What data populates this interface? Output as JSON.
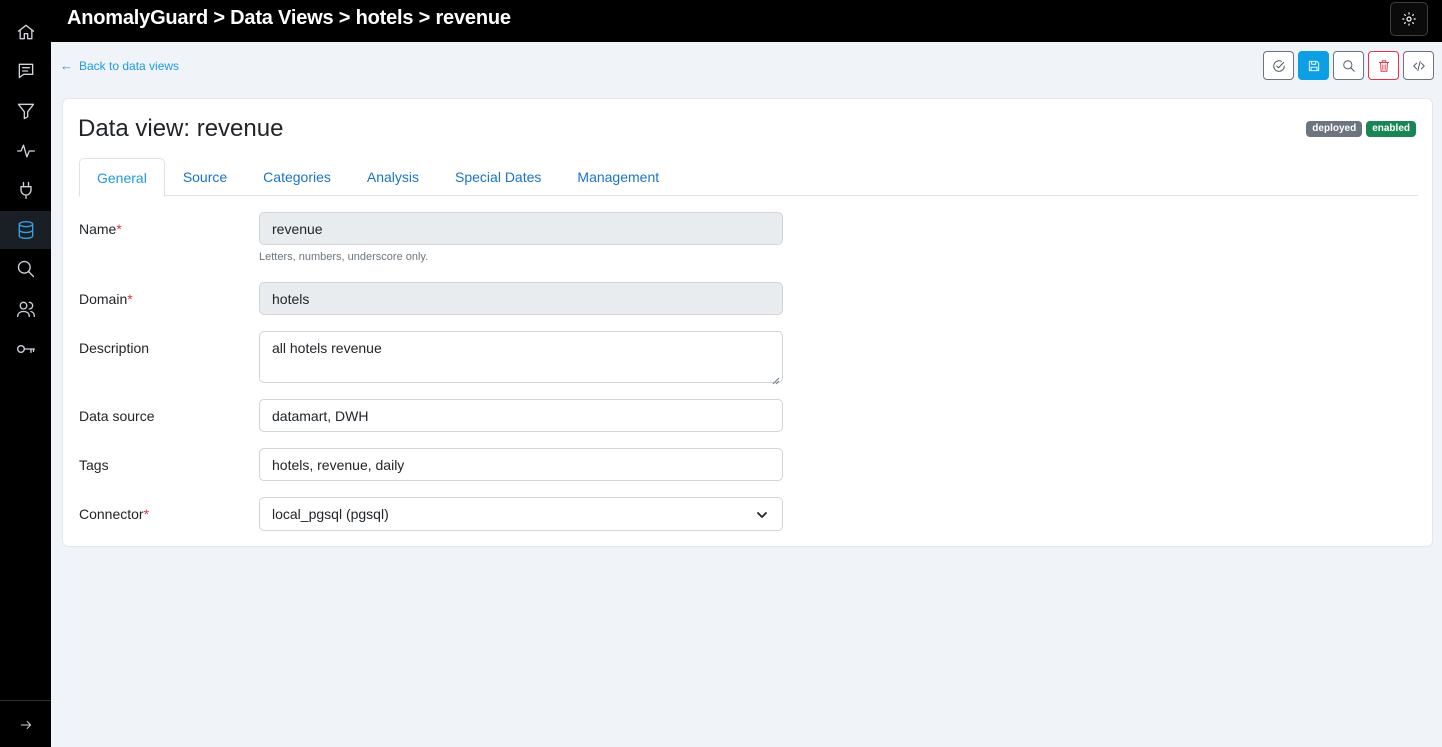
{
  "topbar": {
    "title": "AnomalyGuard > Data Views > hotels > revenue",
    "settings_icon": "gear-icon"
  },
  "sidebar": {
    "items": [
      {
        "name": "home",
        "icon": "home-icon",
        "active": false
      },
      {
        "name": "messages",
        "icon": "message-icon",
        "active": false
      },
      {
        "name": "filters",
        "icon": "filter-icon",
        "active": false
      },
      {
        "name": "activity",
        "icon": "activity-icon",
        "active": false
      },
      {
        "name": "connectors",
        "icon": "plug-icon",
        "active": false
      },
      {
        "name": "data-views",
        "icon": "database-icon",
        "active": true
      },
      {
        "name": "search",
        "icon": "search-icon",
        "active": false
      },
      {
        "name": "users",
        "icon": "users-icon",
        "active": false
      },
      {
        "name": "keys",
        "icon": "key-icon",
        "active": false
      }
    ],
    "expand_icon": "arrow-right-icon"
  },
  "back_link": {
    "arrow": "←",
    "label": "Back to data views"
  },
  "toolbar": {
    "buttons": [
      {
        "name": "validate",
        "icon": "check-circle-icon"
      },
      {
        "name": "save",
        "icon": "save-icon"
      },
      {
        "name": "inspect",
        "icon": "search-icon"
      },
      {
        "name": "delete",
        "icon": "trash-icon"
      },
      {
        "name": "code",
        "icon": "code-icon"
      }
    ]
  },
  "card": {
    "title": "Data view: revenue",
    "badges": [
      "deployed",
      "enabled"
    ]
  },
  "tabs": [
    "General",
    "Source",
    "Categories",
    "Analysis",
    "Special Dates",
    "Management"
  ],
  "active_tab": "General",
  "form": {
    "name": {
      "label": "Name",
      "required": "*",
      "value": "revenue",
      "hint": "Letters, numbers, underscore only."
    },
    "domain": {
      "label": "Domain",
      "required": "*",
      "value": "hotels"
    },
    "description": {
      "label": "Description",
      "value": "all hotels revenue"
    },
    "data_source": {
      "label": "Data source",
      "value": "datamart, DWH"
    },
    "tags": {
      "label": "Tags",
      "value": "hotels, revenue, daily"
    },
    "connector": {
      "label": "Connector",
      "required": "*",
      "value": "local_pgsql (pgsql)"
    }
  },
  "colors": {
    "accent": "#1e9be0",
    "primary_button": "#0d9fe3",
    "danger": "#dc3545",
    "badge_deployed": "#6c757d",
    "badge_enabled": "#198754"
  }
}
